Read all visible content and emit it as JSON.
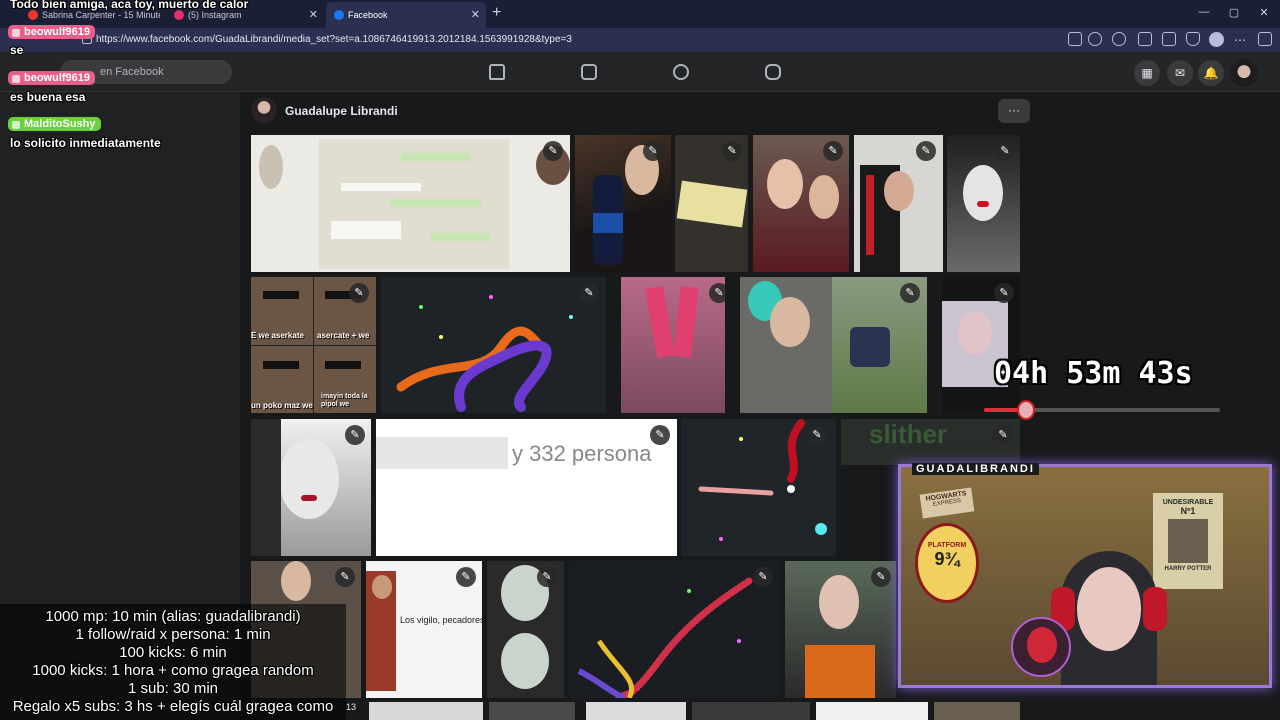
{
  "browser": {
    "tabs": [
      {
        "label": "Sabrina Carpenter - 15 Minutes",
        "favicon_color": "#e33"
      },
      {
        "label": "(5) Instagram",
        "favicon_color": "#e1306c"
      },
      {
        "label": "Facebook",
        "favicon_color": "#1877f2"
      }
    ],
    "close_glyph": "✕",
    "new_tab_glyph": "+",
    "window_controls": [
      "—",
      "▢",
      "✕"
    ],
    "url": "https://www.facebook.com/GuadaLibrandi/media_set?set=a.1086746419913.2012184.1563991928&type=3",
    "menu_glyph": "⋯"
  },
  "facebook": {
    "search_placeholder": "en Facebook",
    "page_name": "Guadalupe Librandi",
    "more_glyph": "···",
    "edit_glyph": "✎",
    "header_buttons": [
      "▦",
      "✉",
      "🔔"
    ]
  },
  "photos": {
    "row2_labels": [
      "E we aserkate",
      "asercate + we",
      "un poko maz we",
      "imayin toda la pipol we"
    ],
    "row3_text": "y 332 persona",
    "row3_watermark": "slither",
    "row4_text": "Los vigilo, pecadores."
  },
  "stream_chat": [
    {
      "type": "text",
      "text": "Todo bien amiga, aca toy, muerto de calor"
    },
    {
      "type": "name",
      "text": "beowulf9619",
      "color": "#e8608a"
    },
    {
      "type": "text",
      "text": "se"
    },
    {
      "type": "name",
      "text": "beowulf9619",
      "color": "#e8608a"
    },
    {
      "type": "text",
      "text": "es buena esa"
    },
    {
      "type": "name",
      "text": "MalditoSushy",
      "color": "#6ad13a"
    },
    {
      "type": "text",
      "text": "lo solicito inmediatamente"
    }
  ],
  "stream_overlay": {
    "timer": "04h 53m 43s",
    "timer_progress": 0.18,
    "webcam_label": "GUADALIBRANDI",
    "poster_text": [
      "UNDESIRABLE",
      "Nº1",
      "HARRY POTTER"
    ],
    "platform_sign": [
      "PLATFORM",
      "9¾"
    ],
    "train_sign": [
      "HOGWARTS",
      "EXPRESS"
    ],
    "rules": [
      "1000 mp: 10 min (alias: guadalibrandi)",
      "1 follow/raid x persona: 1 min",
      "100 kicks: 6 min",
      "1000 kicks: 1 hora + como gragea random",
      "1 sub: 30 min",
      "Regalo x5 subs: 3 hs + elegís cuál gragea como"
    ],
    "corner_number": "13"
  }
}
